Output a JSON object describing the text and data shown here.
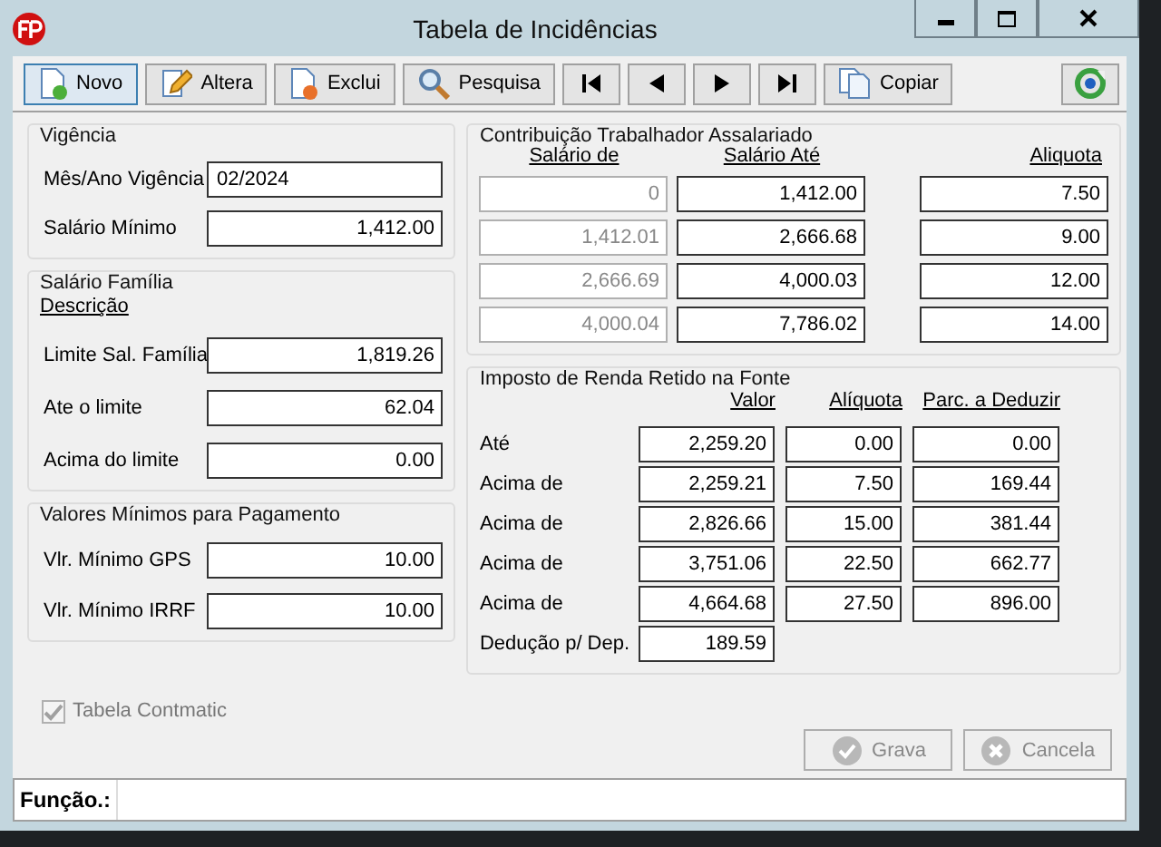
{
  "window": {
    "title": "Tabela de Incidências"
  },
  "toolbar": [
    {
      "kind": "new",
      "label": "Novo",
      "selected": true
    },
    {
      "kind": "edit",
      "label": "Altera",
      "selected": false
    },
    {
      "kind": "delete",
      "label": "Exclui",
      "selected": false
    },
    {
      "kind": "search",
      "label": "Pesquisa",
      "selected": false
    },
    {
      "kind": "first",
      "selected": false
    },
    {
      "kind": "prev",
      "selected": false
    },
    {
      "kind": "next",
      "selected": false
    },
    {
      "kind": "last",
      "selected": false
    },
    {
      "kind": "copy",
      "label": "Copiar",
      "selected": false
    }
  ],
  "left_groups": [
    {
      "title": "Vigência",
      "fields": [
        {
          "label": "Mês/Ano Vigência",
          "value": "02/2024",
          "kind": "text"
        },
        {
          "label": "Salário Mínimo",
          "value": "1,412.00",
          "kind": "number"
        }
      ]
    },
    {
      "title": "Salário Família",
      "subtitle": "Descrição",
      "fields": [
        {
          "label": "Limite Sal. Família",
          "value": "1,819.26",
          "kind": "number"
        },
        {
          "label": "Ate o limite",
          "value": "62.04",
          "kind": "number"
        },
        {
          "label": "Acima do limite",
          "value": "0.00",
          "kind": "number"
        }
      ]
    },
    {
      "title": "Valores Mínimos para Pagamento",
      "fields": [
        {
          "label": "Vlr. Mínimo GPS",
          "value": "10.00",
          "kind": "number"
        },
        {
          "label": "Vlr. Mínimo IRRF",
          "value": "10.00",
          "kind": "number"
        }
      ]
    }
  ],
  "contribution": {
    "title": "Contribuição Trabalhador Assalariado",
    "columns": [
      "Salário de",
      "Salário Até",
      "Aliquota"
    ],
    "rows": [
      {
        "from": "0",
        "from_disabled": true,
        "to": "1,412.00",
        "rate": "7.50"
      },
      {
        "from": "1,412.01",
        "from_disabled": true,
        "to": "2,666.68",
        "rate": "9.00"
      },
      {
        "from": "2,666.69",
        "from_disabled": true,
        "to": "4,000.03",
        "rate": "12.00"
      },
      {
        "from": "4,000.04",
        "from_disabled": true,
        "to": "7,786.02",
        "rate": "14.00"
      }
    ]
  },
  "income_tax": {
    "title": "Imposto de Renda Retido na Fonte",
    "columns": [
      "Valor",
      "Alíquota",
      "Parc. a Deduzir"
    ],
    "rows": [
      {
        "label": "Até",
        "value": "2,259.20",
        "rate": "0.00",
        "deduction": "0.00"
      },
      {
        "label": "Acima de",
        "value": "2,259.21",
        "rate": "7.50",
        "deduction": "169.44"
      },
      {
        "label": "Acima de",
        "value": "2,826.66",
        "rate": "15.00",
        "deduction": "381.44"
      },
      {
        "label": "Acima de",
        "value": "3,751.06",
        "rate": "22.50",
        "deduction": "662.77"
      },
      {
        "label": "Acima de",
        "value": "4,664.68",
        "rate": "27.50",
        "deduction": "896.00"
      }
    ],
    "dependent": {
      "label": "Dedução p/ Dep.",
      "value": "189.59"
    }
  },
  "checkbox": {
    "label": "Tabela Contmatic",
    "checked": true,
    "disabled": true
  },
  "buttons": [
    {
      "kind": "save",
      "label": "Grava",
      "disabled": true
    },
    {
      "kind": "cancel",
      "label": "Cancela",
      "disabled": true
    }
  ],
  "status_bar": {
    "label": "Função.:"
  }
}
